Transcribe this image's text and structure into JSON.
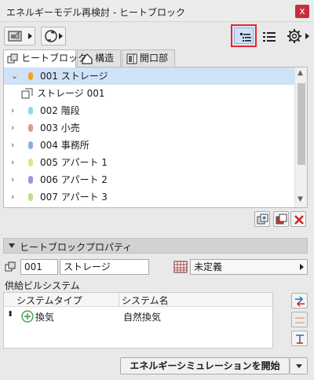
{
  "window": {
    "title": "エネルギーモデル再検討 - ヒートブロック",
    "close_icon": "close-icon",
    "close_glyph": "x"
  },
  "tabs": [
    {
      "label": "ヒートブロック",
      "icon": "heatblock-icon",
      "active": true
    },
    {
      "label": "構造",
      "icon": "house-structure-icon",
      "active": false
    },
    {
      "label": "開口部",
      "icon": "opening-door-icon",
      "active": false
    }
  ],
  "tree": {
    "items": [
      {
        "label": "001 ストレージ",
        "color": "#f0a530",
        "expanded": true,
        "selected": true,
        "chevron": "⌄"
      },
      {
        "label": "ストレージ 001",
        "child": true,
        "icon": "zone-icon"
      },
      {
        "label": "002 階段",
        "color": "#8fdce8",
        "chevron": "›"
      },
      {
        "label": "003 小売",
        "color": "#dca088",
        "chevron": "›"
      },
      {
        "label": "004 事務所",
        "color": "#8eaee0",
        "chevron": "›"
      },
      {
        "label": "005 アパート 1",
        "color": "#e7e090",
        "chevron": "›"
      },
      {
        "label": "006 アパート 2",
        "color": "#a690dd",
        "chevron": "›"
      },
      {
        "label": "007 アパート 3",
        "color": "#bde090",
        "chevron": "›"
      }
    ]
  },
  "properties": {
    "header": "ヒートブロックプロパティ",
    "id_value": "001",
    "name_value": "ストレージ",
    "category_value": "未定義",
    "supply_label": "供給ビルシステム",
    "table_headers": [
      "システムタイプ",
      "システム名"
    ],
    "rows": [
      {
        "type": "換気",
        "name": "自然換気",
        "icon": "fan-icon"
      }
    ]
  },
  "footer": {
    "start_button": "エネルギーシミュレーションを開始"
  },
  "colors": {
    "highlight_border": "#e8262f",
    "delete_red": "#d0231f"
  }
}
